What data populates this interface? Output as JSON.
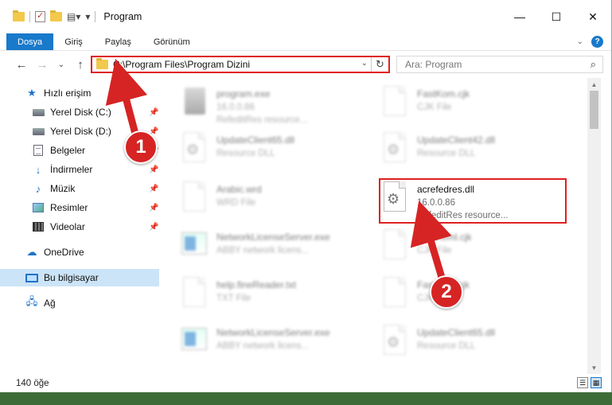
{
  "window": {
    "title": "Program"
  },
  "ribbon": {
    "tabs": [
      "Dosya",
      "Giriş",
      "Paylaş",
      "Görünüm"
    ],
    "help_label": "?"
  },
  "navigation": {
    "address": "C:\\Program Files\\Program Dizini",
    "search_placeholder": "Ara: Program"
  },
  "sidebar": {
    "items": [
      {
        "label": "Hızlı erişim",
        "icon": "star-icon"
      },
      {
        "label": "Yerel Disk (C:)",
        "icon": "disk-icon"
      },
      {
        "label": "Yerel Disk (D:)",
        "icon": "disk-icon"
      },
      {
        "label": "Belgeler",
        "icon": "documents-icon"
      },
      {
        "label": "İndirmeler",
        "icon": "download-icon"
      },
      {
        "label": "Müzik",
        "icon": "music-icon"
      },
      {
        "label": "Resimler",
        "icon": "pictures-icon"
      },
      {
        "label": "Videolar",
        "icon": "video-icon"
      },
      {
        "label": "OneDrive",
        "icon": "cloud-icon"
      },
      {
        "label": "Bu bilgisayar",
        "icon": "computer-icon"
      },
      {
        "label": "Ağ",
        "icon": "network-icon"
      }
    ]
  },
  "files": [
    {
      "name": "program.exe",
      "line2": "16.0.0.86",
      "line3": "RefeditRes resource..."
    },
    {
      "name": "FastKom.cjk",
      "line2": "CJK File",
      "line3": ""
    },
    {
      "name": "UpdateClient65.dll",
      "line2": "Resource DLL",
      "line3": ""
    },
    {
      "name": "UpdateClient42.dll",
      "line2": "Resource DLL",
      "line3": ""
    },
    {
      "name": "Arabic.wrd",
      "line2": "WRD File",
      "line3": ""
    },
    {
      "name": "acrefedres.dll",
      "line2": "16.0.0.86",
      "line3": "RefeditRes resource..."
    },
    {
      "name": "NetworkLicenseServer.exe",
      "line2": "ABBY network licens...",
      "line3": ""
    },
    {
      "name": "FastKeml.cjk",
      "line2": "CJK File",
      "line3": ""
    },
    {
      "name": "help.fineReader.txt",
      "line2": "TXT File",
      "line3": ""
    },
    {
      "name": "FastKom.cjk",
      "line2": "CJK File",
      "line3": ""
    },
    {
      "name": "NetworkLicenseServer.exe",
      "line2": "ABBY network licens...",
      "line3": ""
    },
    {
      "name": "UpdateClient65.dll",
      "line2": "Resource DLL",
      "line3": ""
    }
  ],
  "status": {
    "item_count": "140 öğe"
  },
  "annotations": {
    "step1": "1",
    "step2": "2"
  },
  "colors": {
    "accent": "#1979ca",
    "callout": "#d62424"
  }
}
